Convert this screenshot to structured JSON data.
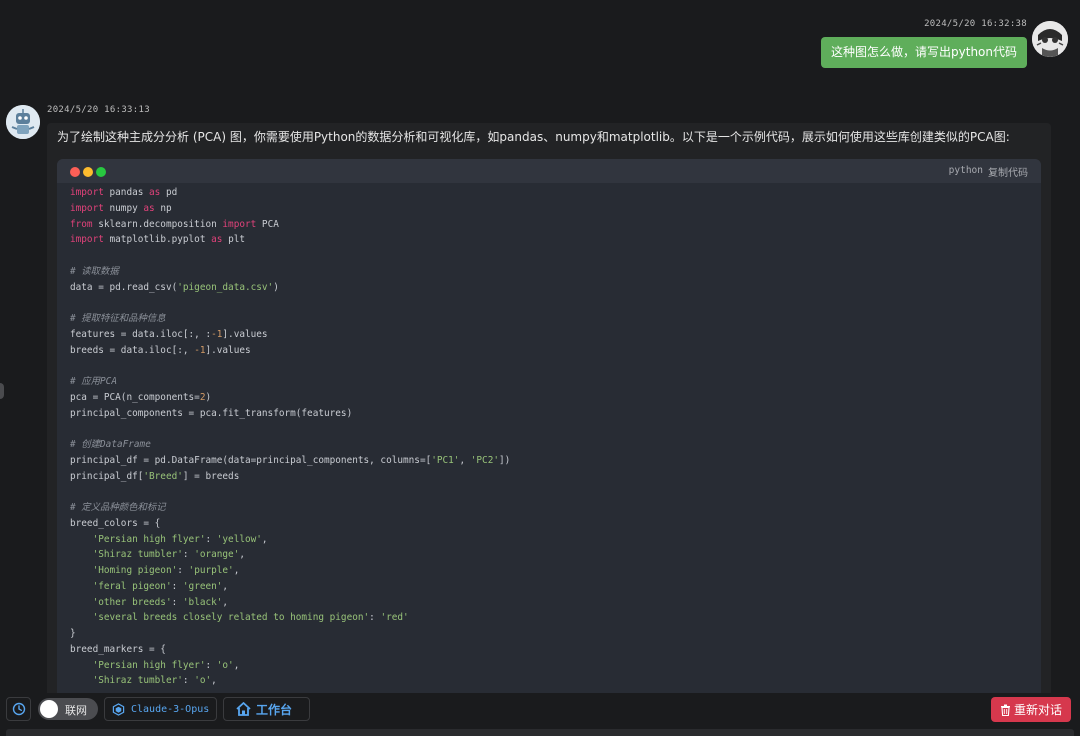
{
  "user_message": {
    "timestamp": "2024/5/20 16:32:38",
    "text": "这种图怎么做，请写出python代码",
    "bubble_color": "#5fae5b"
  },
  "assistant_message": {
    "timestamp": "2024/5/20 16:33:13",
    "intro": "为了绘制这种主成分分析 (PCA) 图，你需要使用Python的数据分析和可视化库，如pandas、numpy和matplotlib。以下是一个示例代码，展示如何使用这些库创建类似的PCA图:",
    "code_block": {
      "language": "python",
      "copy_label": "复制代码",
      "lines": [
        "import pandas as pd",
        "import numpy as np",
        "from sklearn.decomposition import PCA",
        "import matplotlib.pyplot as plt",
        "",
        "# 读取数据",
        "data = pd.read_csv('pigeon_data.csv')",
        "",
        "# 提取特征和品种信息",
        "features = data.iloc[:, :-1].values",
        "breeds = data.iloc[:, -1].values",
        "",
        "# 应用PCA",
        "pca = PCA(n_components=2)",
        "principal_components = pca.fit_transform(features)",
        "",
        "# 创建DataFrame",
        "principal_df = pd.DataFrame(data=principal_components, columns=['PC1', 'PC2'])",
        "principal_df['Breed'] = breeds",
        "",
        "# 定义品种颜色和标记",
        "breed_colors = {",
        "    'Persian high flyer': 'yellow',",
        "    'Shiraz tumbler': 'orange',",
        "    'Homing pigeon': 'purple',",
        "    'feral pigeon': 'green',",
        "    'other breeds': 'black',",
        "    'several breeds closely related to homing pigeon': 'red'",
        "}",
        "breed_markers = {",
        "    'Persian high flyer': 'o',",
        "    'Shiraz tumbler': 'o',"
      ]
    }
  },
  "toolbar": {
    "history_icon": "clock-icon",
    "network_toggle_label": "联网",
    "network_enabled": false,
    "model_icon": "cube-icon",
    "model_name": "Claude-3-Opus",
    "workspace_icon": "home-icon",
    "workspace_label": "工作台",
    "reset_icon": "trash-icon",
    "reset_label": "重新对话",
    "accent_color": "#58a6f0",
    "reset_color": "#d6384d"
  }
}
